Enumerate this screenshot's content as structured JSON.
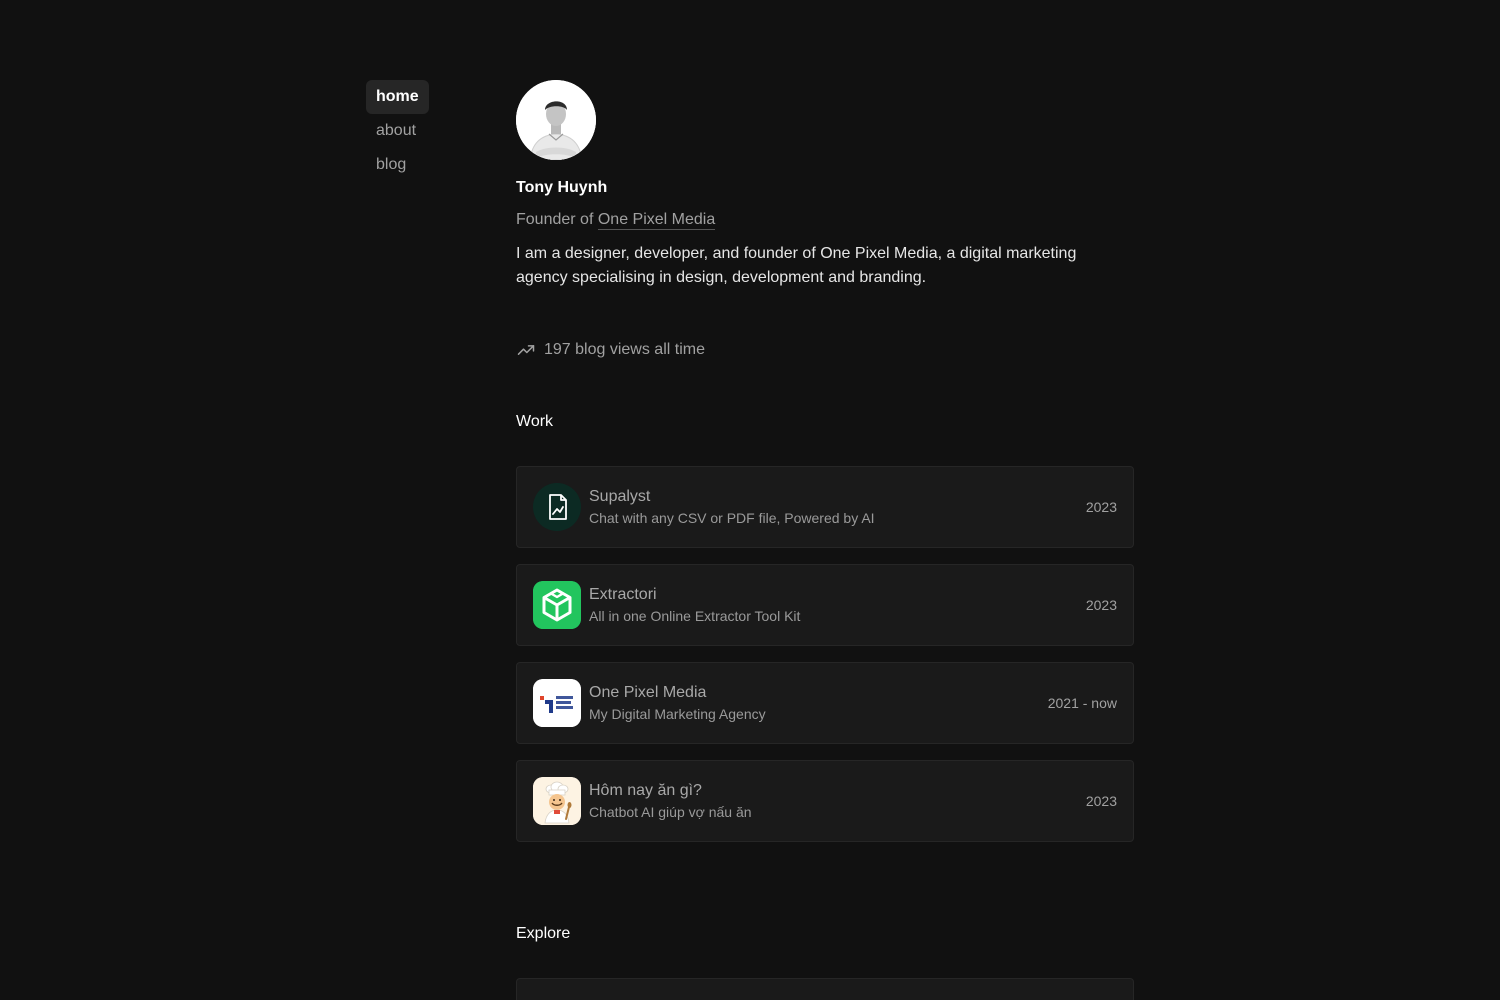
{
  "nav": {
    "items": [
      {
        "label": "home",
        "active": true
      },
      {
        "label": "about",
        "active": false
      },
      {
        "label": "blog",
        "active": false
      }
    ]
  },
  "profile": {
    "name": "Tony Huynh",
    "role_prefix": "Founder of",
    "role_link": "One Pixel Media",
    "bio": "I am a designer, developer, and founder of One Pixel Media, a digital marketing agency specialising in design, development and branding."
  },
  "stats": {
    "views_text": "197 blog views all time",
    "icon": "trending-up-icon"
  },
  "work": {
    "title": "Work",
    "items": [
      {
        "title": "Supalyst",
        "subtitle": "Chat with any CSV or PDF file, Powered by AI",
        "year": "2023",
        "icon": "file-chart-icon",
        "color": "#0d2b24"
      },
      {
        "title": "Extractori",
        "subtitle": "All in one Online Extractor Tool Kit",
        "year": "2023",
        "icon": "cube-icon",
        "color": "#22c55e"
      },
      {
        "title": "One Pixel Media",
        "subtitle": "My Digital Marketing Agency",
        "year": "2021 - now",
        "icon": "one-pixel-media-logo",
        "color": "#ffffff"
      },
      {
        "title": "Hôm nay ăn gì?",
        "subtitle": "Chatbot AI giúp vợ nấu ăn",
        "year": "2023",
        "icon": "chef-icon",
        "color": "#fdf3e3"
      }
    ]
  },
  "explore": {
    "title": "Explore"
  }
}
